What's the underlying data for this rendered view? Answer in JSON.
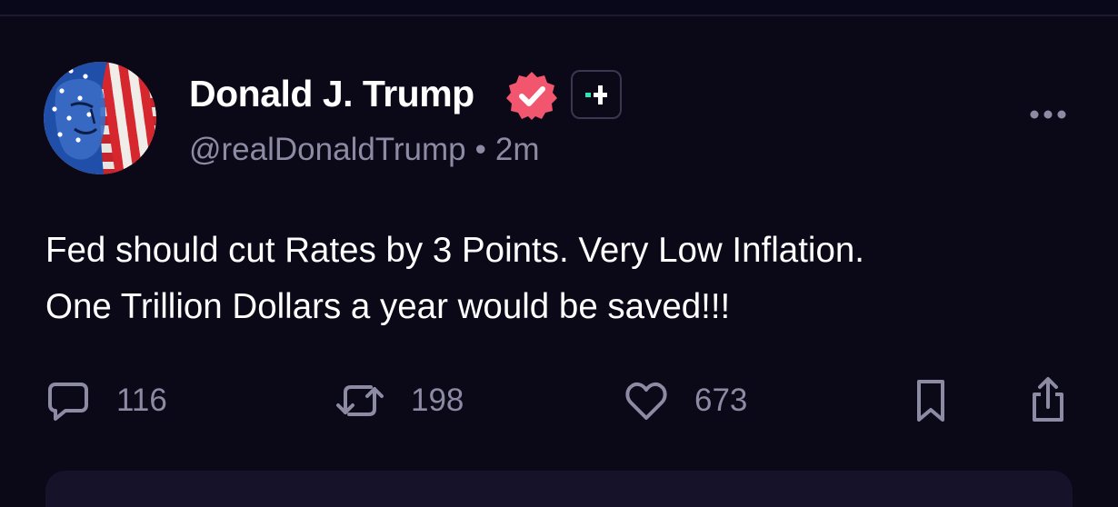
{
  "post": {
    "author_name": "Donald J. Trump",
    "handle": "@realDonaldTrump",
    "separator": "•",
    "time_ago": "2m",
    "text_line1": "Fed should cut Rates by 3 Points. Very Low Inflation.",
    "text_line2": "One Trillion Dollars a year would be saved!!!",
    "verified_color": "#f2566e",
    "plus_color": "#2fe3b5"
  },
  "actions": {
    "reply_count": "116",
    "repost_count": "198",
    "like_count": "673"
  },
  "icons": {
    "avatar": "avatar-flag-portrait",
    "verified": "verified-badge-icon",
    "plus": "plus-badge-icon",
    "more": "more-dots-icon",
    "reply": "comment-icon",
    "repost": "repost-icon",
    "like": "heart-icon",
    "bookmark": "bookmark-icon",
    "share": "share-icon"
  },
  "colors": {
    "background": "#0b0818",
    "text_primary": "#ffffff",
    "text_secondary": "#8d8aa3"
  }
}
